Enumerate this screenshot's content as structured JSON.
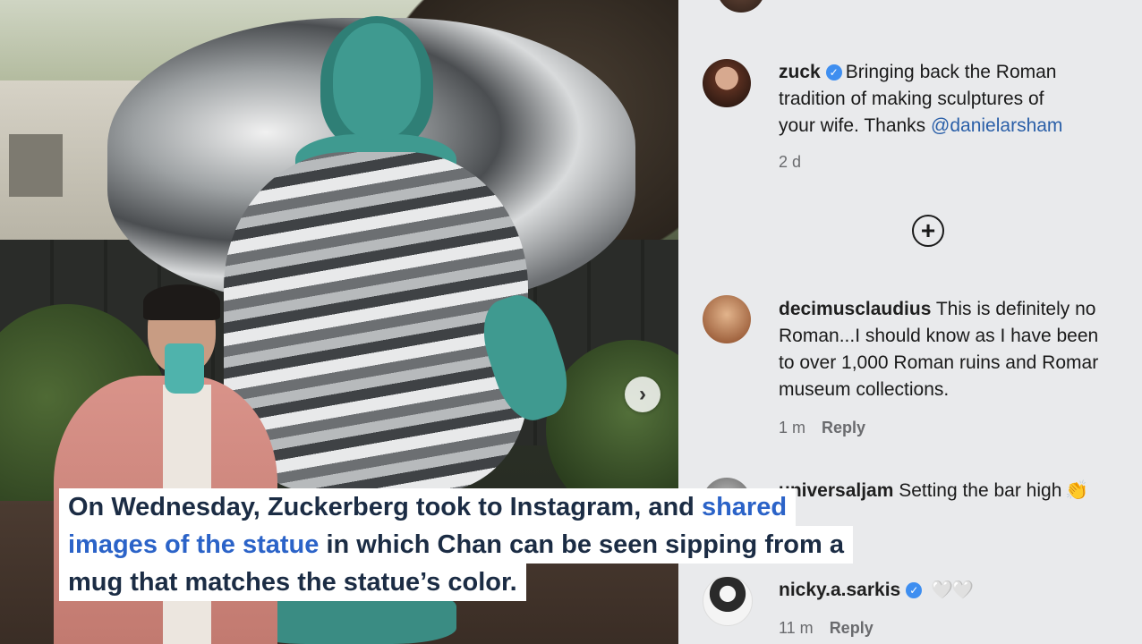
{
  "photo": {
    "carousel_next_icon": "chevron-right-icon"
  },
  "comments": [
    {
      "username": "zuck",
      "verified": true,
      "text_before": "Bringing back the Roman",
      "text_line2": "tradition of making sculptures of",
      "text_line3_prefix": "your wife. Thanks ",
      "mention": "@danielarsham",
      "time": "2 d"
    },
    {
      "username": "decimusclaudius",
      "line1": "This is definitely no",
      "line2": "Roman...I should know as I have been",
      "line3": "to over 1,000 Roman ruins and Romar",
      "line4": "museum collections.",
      "time": "1 m",
      "reply_label": "Reply"
    },
    {
      "username_partial": "universaljam",
      "text": "Setting the bar high",
      "emoji": "👏"
    },
    {
      "username": "nicky.a.sarkis",
      "verified": true,
      "emoji": "🤍🤍",
      "time": "11 m",
      "reply_label": "Reply"
    }
  ],
  "load_more_icon": "plus-circle-icon",
  "caption": {
    "line1_prefix": "On Wednesday, Zuckerberg took to Instagram, and ",
    "line1_link": "shared",
    "line2_link": "images of the statue",
    "line2_suffix": " in which Chan can be seen sipping from a",
    "line3": "mug that matches the statue’s color."
  },
  "colors": {
    "panel_bg": "#e9eaec",
    "verified": "#3e8ef0",
    "mention": "#2a5fa8",
    "caption_link": "#2b63c8",
    "caption_text": "#1b2c44"
  }
}
